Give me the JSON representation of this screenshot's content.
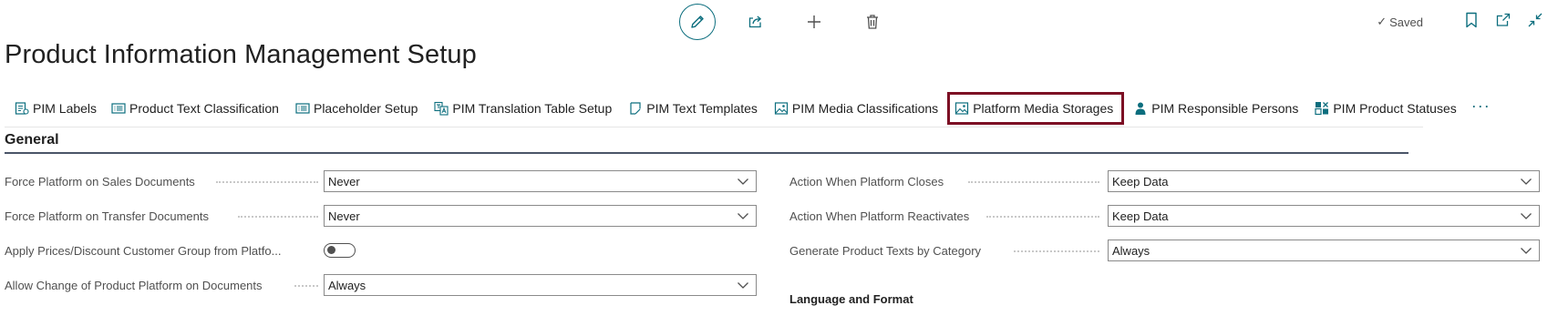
{
  "toolbar": {
    "icons": [
      "pencil-icon",
      "share-icon",
      "plus-icon",
      "trash-icon"
    ]
  },
  "status": {
    "saved_label": "Saved",
    "icons": [
      "bookmark-icon",
      "open-in-new-window-icon",
      "collapse-icon"
    ]
  },
  "page": {
    "title": "Product Information Management Setup"
  },
  "actions": {
    "items": [
      {
        "label": "PIM Labels",
        "icon": "label-list-icon"
      },
      {
        "label": "Product Text Classification",
        "icon": "list-icon"
      },
      {
        "label": "Placeholder Setup",
        "icon": "list-icon"
      },
      {
        "label": "PIM Translation Table Setup",
        "icon": "translate-icon"
      },
      {
        "label": "PIM Text Templates",
        "icon": "template-icon"
      },
      {
        "label": "PIM Media Classifications",
        "icon": "image-icon"
      },
      {
        "label": "Platform Media Storages",
        "icon": "image-icon",
        "highlighted": true
      },
      {
        "label": "PIM Responsible Persons",
        "icon": "person-icon"
      },
      {
        "label": "PIM Product Statuses",
        "icon": "status-icon"
      }
    ],
    "more": "···"
  },
  "general": {
    "title": "General",
    "left_fields": [
      {
        "label": "Force Platform on Sales Documents",
        "value": "Never",
        "type": "select"
      },
      {
        "label": "Force Platform on Transfer Documents",
        "value": "Never",
        "type": "select"
      },
      {
        "label": "Apply Prices/Discount Customer Group from Platfo...",
        "value": false,
        "type": "toggle"
      },
      {
        "label": "Allow Change of Product Platform on Documents",
        "value": "Always",
        "type": "select"
      }
    ],
    "right_fields": [
      {
        "label": "Action When Platform Closes",
        "value": "Keep Data",
        "type": "select"
      },
      {
        "label": "Action When Platform Reactivates",
        "value": "Keep Data",
        "type": "select"
      },
      {
        "label": "Generate Product Texts by Category",
        "value": "Always",
        "type": "select"
      }
    ],
    "subgroup_title": "Language and Format"
  },
  "colors": {
    "accent": "#0c6e7e",
    "highlight_border": "#7c0f24",
    "text": "#212121",
    "label": "#505050"
  }
}
